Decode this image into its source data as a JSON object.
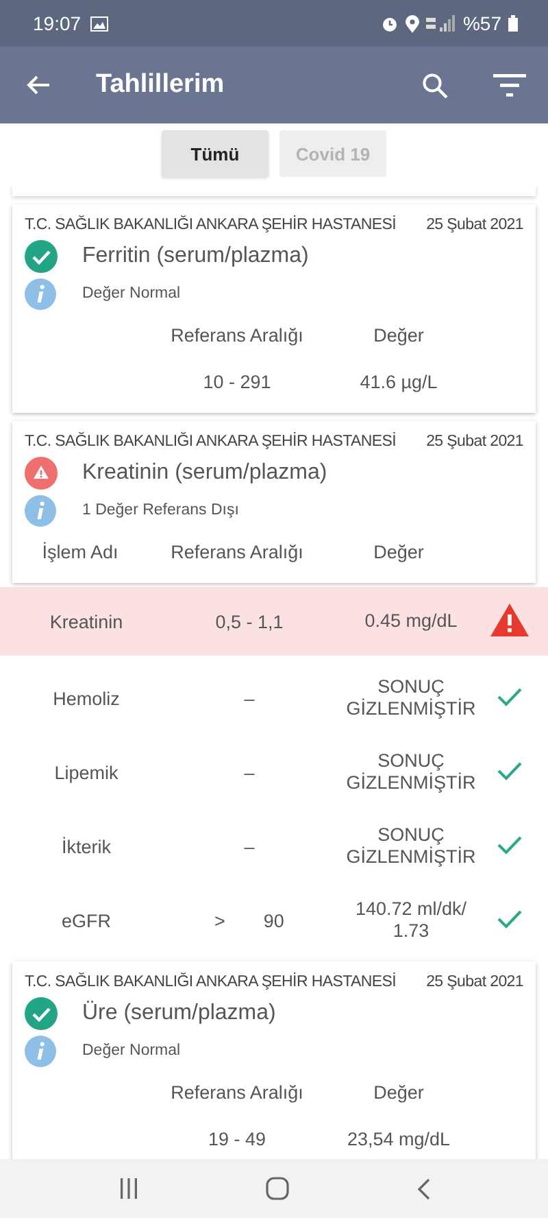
{
  "status_bar": {
    "time": "19:07",
    "battery": "%57"
  },
  "app_bar": {
    "title": "Tahlillerim"
  },
  "filters": [
    {
      "label": "Tümü",
      "selected": true
    },
    {
      "label": "Covid 19",
      "selected": false
    }
  ],
  "results": [
    {
      "hospital": "T.C. SAĞLIK BAKANLIĞI ANKARA ŞEHİR HASTANESİ",
      "date": "25 Şubat 2021",
      "normal": true,
      "title": "Ferritin (serum/plazma)",
      "info": "Değer Normal",
      "expanded": false,
      "columns": [
        "",
        "Referans Aralığı",
        "Değer"
      ],
      "rows": [
        {
          "name": "",
          "range": "10 - 291",
          "value": "41.6 µg/L"
        }
      ]
    },
    {
      "hospital": "T.C. SAĞLIK BAKANLIĞI ANKARA ŞEHİR HASTANESİ",
      "date": "25 Şubat 2021",
      "normal": false,
      "title": "Kreatinin (serum/plazma)",
      "info": "1 Değer Referans Dışı",
      "expanded": true,
      "columns": [
        "İşlem Adı",
        "Referans Aralığı",
        "Değer"
      ],
      "rows": [
        {
          "name": "Kreatinin",
          "range": "0,5 - 1,1",
          "value": "0.45 mg/dL",
          "out_of_range": true
        },
        {
          "name": "Hemoliz",
          "range": "–",
          "value": "SONUÇ\nGİZLENMİŞTİR",
          "out_of_range": false
        },
        {
          "name": "Lipemik",
          "range": "–",
          "value": "SONUÇ\nGİZLENMİŞTİR",
          "out_of_range": false
        },
        {
          "name": "İkterik",
          "range": "–",
          "value": "SONUÇ\nGİZLENMİŞTİR",
          "out_of_range": false
        },
        {
          "name": "eGFR",
          "range_op": ">",
          "range": "90",
          "value": "140.72 ml/dk/\n1.73",
          "out_of_range": false
        }
      ]
    },
    {
      "hospital": "T.C. SAĞLIK BAKANLIĞI ANKARA ŞEHİR HASTANESİ",
      "date": "25 Şubat 2021",
      "normal": true,
      "title": "Üre (serum/plazma)",
      "info": "Değer Normal",
      "expanded": false,
      "columns": [
        "",
        "Referans Aralığı",
        "Değer"
      ],
      "rows": [
        {
          "name": "",
          "range": "19 - 49",
          "value": "23,54 mg/dL"
        }
      ]
    }
  ]
}
